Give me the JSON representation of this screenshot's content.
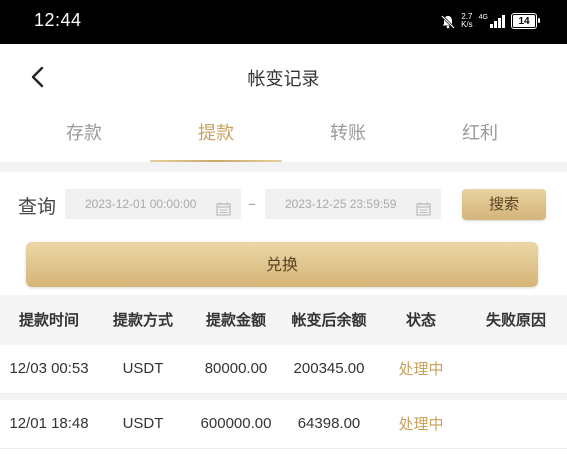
{
  "status_bar": {
    "time": "12:44",
    "net_speed_top": "2.7",
    "net_speed_bottom": "K/s",
    "network_type": "4G",
    "battery": "14",
    "icons": [
      "mute-icon",
      "signal-icon",
      "battery-icon"
    ]
  },
  "header": {
    "title": "帐变记录",
    "back_icon": "chevron-left-icon"
  },
  "tabs": [
    {
      "label": "存款",
      "active": false
    },
    {
      "label": "提款",
      "active": true
    },
    {
      "label": "转账",
      "active": false
    },
    {
      "label": "红利",
      "active": false
    }
  ],
  "query": {
    "label": "查询",
    "start_date": "2023-12-01 00:00:00",
    "end_date": "2023-12-25 23:59:59",
    "separator": "–",
    "search_label": "搜索"
  },
  "exchange_label": "兑换",
  "table": {
    "columns": [
      "提款时间",
      "提款方式",
      "提款金额",
      "帐变后余额",
      "状态",
      "失败原因"
    ],
    "rows": [
      {
        "time": "12/03 00:53",
        "method": "USDT",
        "amount": "80000.00",
        "balance": "200345.00",
        "status": "处理中",
        "reason": ""
      },
      {
        "time": "12/01 18:48",
        "method": "USDT",
        "amount": "600000.00",
        "balance": "64398.00",
        "status": "处理中",
        "reason": ""
      }
    ]
  },
  "colors": {
    "accent": "#c8a25c",
    "button_gradient_top": "#ecd7a7",
    "button_gradient_bottom": "#d5b477"
  }
}
